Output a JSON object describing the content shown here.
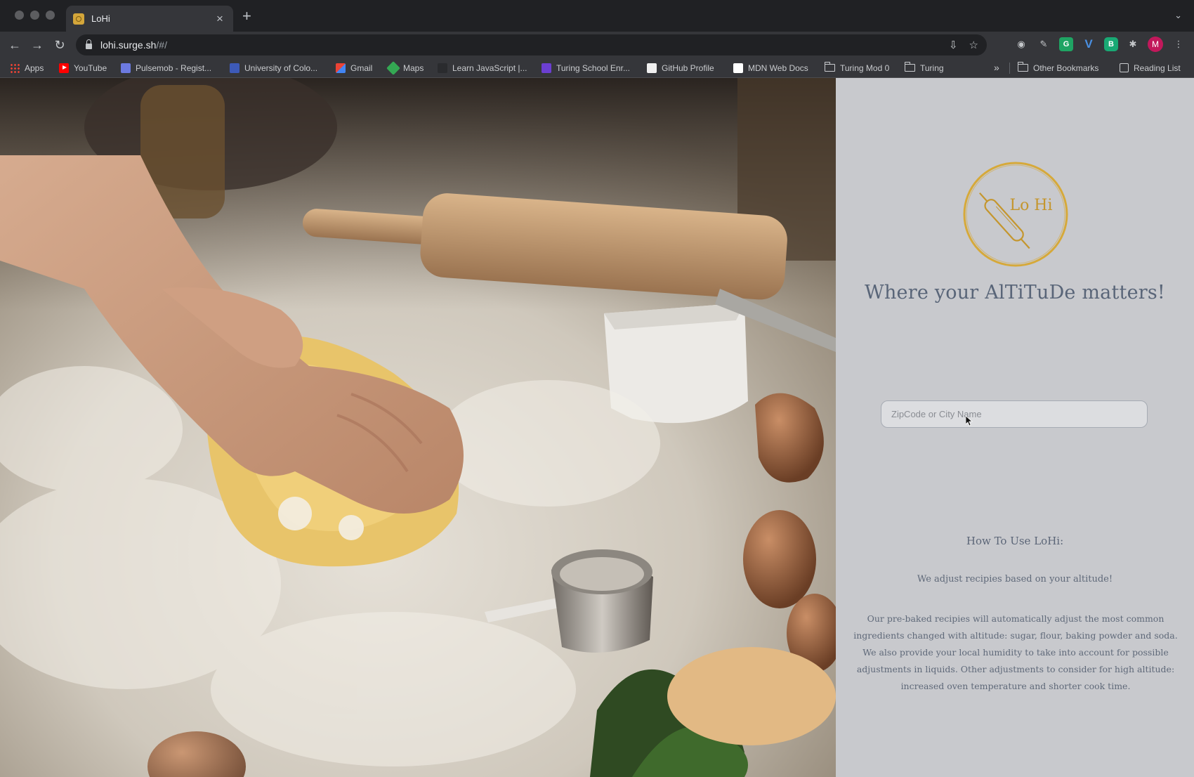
{
  "browser": {
    "tab": {
      "title": "LoHi"
    },
    "url": {
      "host": "lohi.surge.sh",
      "path": "/#/"
    },
    "bookmarks": [
      {
        "label": "Apps"
      },
      {
        "label": "YouTube"
      },
      {
        "label": "Pulsemob - Regist..."
      },
      {
        "label": "University of Colo..."
      },
      {
        "label": "Gmail"
      },
      {
        "label": "Maps"
      },
      {
        "label": "Learn JavaScript |..."
      },
      {
        "label": "Turing School Enr..."
      },
      {
        "label": "GitHub  Profile"
      },
      {
        "label": "MDN Web Docs"
      },
      {
        "label": "Turing Mod 0"
      },
      {
        "label": "Turing"
      }
    ],
    "other_bookmarks": "Other Bookmarks",
    "reading_list": "Reading List",
    "profile_initial": "M"
  },
  "app": {
    "logo_text": "Lo Hi",
    "tagline": "Where your AlTiTuDe matters!",
    "search": {
      "placeholder": "ZipCode or City Name",
      "value": ""
    },
    "how_to": {
      "title": "How To Use LoHi:",
      "subtitle": "We adjust recipies based on your altitude!",
      "body": "Our pre-baked recipies will automatically adjust the most common ingredients changed with altitude: sugar, flour, baking powder and soda. We also provide your local humidity to take into account for possible adjustments in liquids. Other adjustments to consider for high altitude: increased oven temperature and shorter cook time."
    }
  },
  "colors": {
    "panel_bg": "#c8c9cd",
    "logo_gold": "#d6a93a",
    "text_slate": "#596578"
  }
}
